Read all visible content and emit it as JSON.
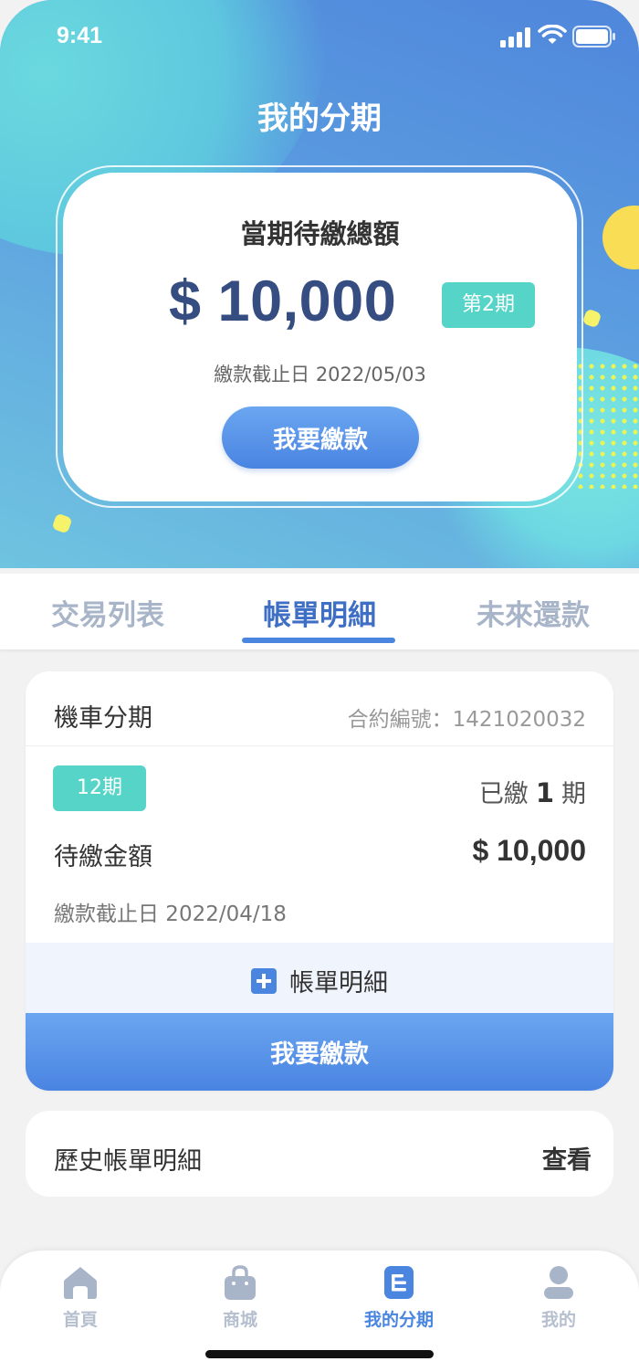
{
  "status_bar": {
    "time": "9:41",
    "icons": [
      "signal-icon",
      "wifi-icon",
      "battery-icon"
    ]
  },
  "header": {
    "title": "我的分期"
  },
  "summary": {
    "label": "當期待繳總額",
    "amount": "$ 10,000",
    "period_badge": "第2期",
    "due_date": "繳款截止日 2022/05/03",
    "pay_button": "我要繳款"
  },
  "tabs": [
    {
      "label": "交易列表",
      "active": false
    },
    {
      "label": "帳單明細",
      "active": true
    },
    {
      "label": "未來還款",
      "active": false
    }
  ],
  "bill": {
    "title": "機車分期",
    "contract": "合約編號：1421020032",
    "term_badge": "12期",
    "paid_prefix": "已繳",
    "paid_count": "1",
    "paid_suffix": "期",
    "due_label": "待繳金額",
    "due_amount": "$ 10,000",
    "deadline": "繳款截止日 2022/04/18",
    "detail_label": "帳單明細",
    "pay_button": "我要繳款"
  },
  "history": {
    "label": "歷史帳單明細",
    "action": "查看"
  },
  "bottom_nav": [
    {
      "label": "首頁",
      "icon": "home-icon",
      "active": false
    },
    {
      "label": "商城",
      "icon": "shopping-bag-icon",
      "active": false
    },
    {
      "label": "我的分期",
      "icon": "installment-icon",
      "active": true
    },
    {
      "label": "我的",
      "icon": "user-icon",
      "active": false
    }
  ],
  "colors": {
    "accent": "#4a86e0",
    "badge": "#55d4c7",
    "amount": "#354d80",
    "header_gradient": [
      "#4f86db",
      "#6fc4e0"
    ]
  }
}
